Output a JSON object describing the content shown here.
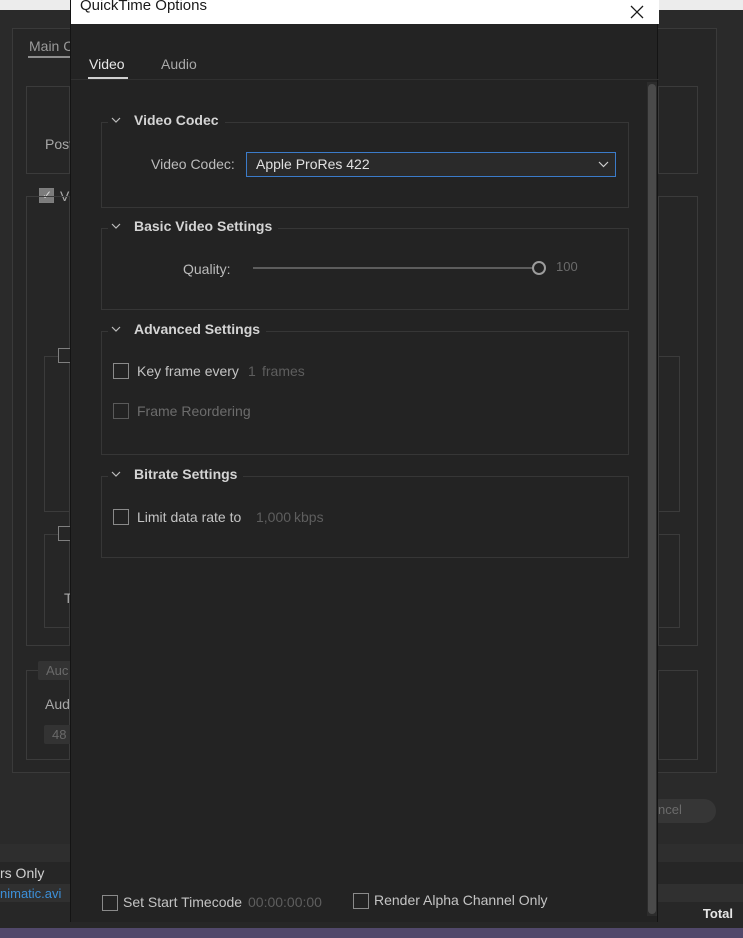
{
  "background": {
    "main_tab": "Main C",
    "post_label": "Post",
    "check_label": "V",
    "t_label": "T",
    "audio_tab": "Auc",
    "audio_label": "Aud",
    "audio_value": "48",
    "cancel_btn": "ncel",
    "bottom_left_text": "rs Only",
    "bottom_file": "nimatic.avi",
    "total_label": "Total"
  },
  "dialog": {
    "title": "QuickTime Options",
    "tabs": [
      {
        "label": "Video",
        "active": true
      },
      {
        "label": "Audio",
        "active": false
      }
    ],
    "sections": {
      "video_codec": {
        "title": "Video Codec",
        "codec_label": "Video Codec:",
        "codec_value": "Apple ProRes 422"
      },
      "basic_video": {
        "title": "Basic Video Settings",
        "quality_label": "Quality:",
        "quality_value": "100"
      },
      "advanced": {
        "title": "Advanced Settings",
        "key_frame_label": "Key frame every",
        "key_frame_value": "1",
        "key_frame_unit": "frames",
        "frame_reordering_label": "Frame Reordering"
      },
      "bitrate": {
        "title": "Bitrate Settings",
        "limit_label": "Limit data rate to",
        "limit_value": "1,000",
        "limit_unit": "kbps"
      }
    },
    "footer": {
      "start_timecode_label": "Set Start Timecode",
      "start_timecode_value": "00:00:00:00",
      "alpha_label": "Render Alpha Channel Only"
    }
  }
}
